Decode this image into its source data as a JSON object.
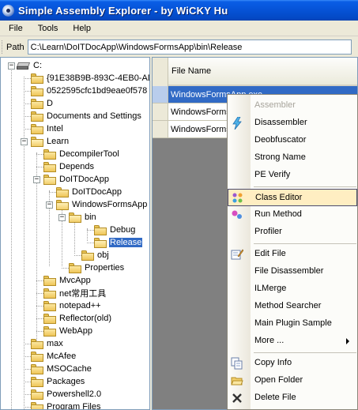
{
  "window": {
    "title": "Simple Assembly Explorer - by WiCKY Hu"
  },
  "menu": {
    "items": [
      "File",
      "Tools",
      "Help"
    ]
  },
  "path": {
    "label": "Path",
    "value": "C:\\Learn\\DoITDocApp\\WindowsFormsApp\\bin\\Release"
  },
  "tree": {
    "root": "C:",
    "nodes": [
      {
        "label": "{91E38B9B-893C-4EB0-AD"
      },
      {
        "label": "0522595cfc1bd9eae0f578"
      },
      {
        "label": "D"
      },
      {
        "label": "Documents and Settings"
      },
      {
        "label": "Intel"
      },
      {
        "label": "Learn"
      },
      {
        "label": "DecompilerTool"
      },
      {
        "label": "Depends"
      },
      {
        "label": "DoITDocApp"
      },
      {
        "label": "DoITDocApp"
      },
      {
        "label": "WindowsFormsApp"
      },
      {
        "label": "bin"
      },
      {
        "label": "Debug"
      },
      {
        "label": "Release"
      },
      {
        "label": "obj"
      },
      {
        "label": "Properties"
      },
      {
        "label": "MvcApp"
      },
      {
        "label": "net常用工具"
      },
      {
        "label": "notepad++"
      },
      {
        "label": "Reflector(old)"
      },
      {
        "label": "WebApp"
      },
      {
        "label": "max"
      },
      {
        "label": "McAfee"
      },
      {
        "label": "MSOCache"
      },
      {
        "label": "Packages"
      },
      {
        "label": "Powershell2.0"
      },
      {
        "label": "Program Files"
      }
    ]
  },
  "list": {
    "column_header": "File Name",
    "rows": [
      "WindowsFormsApp.exe",
      "WindowsFormsApp.pdb",
      "WindowsFormsApp.vshost.exe"
    ]
  },
  "context_menu": {
    "items": [
      {
        "label": "Assembler",
        "icon": "none",
        "disabled": true
      },
      {
        "label": "Disassembler",
        "icon": "lightning-icon"
      },
      {
        "label": "Deobfuscator",
        "icon": "none"
      },
      {
        "label": "Strong Name",
        "icon": "none"
      },
      {
        "label": "PE Verify",
        "icon": "none"
      },
      {
        "label": "Class Editor",
        "icon": "class-editor-icon",
        "highlighted": true
      },
      {
        "label": "Run Method",
        "icon": "run-method-icon"
      },
      {
        "label": "Profiler",
        "icon": "none"
      },
      {
        "label": "Edit File",
        "icon": "edit-file-icon"
      },
      {
        "label": "File Disassembler",
        "icon": "none"
      },
      {
        "label": "ILMerge",
        "icon": "none"
      },
      {
        "label": "Method Searcher",
        "icon": "none"
      },
      {
        "label": "Main Plugin Sample",
        "icon": "none"
      },
      {
        "label": "More ...",
        "icon": "none",
        "submenu": true
      },
      {
        "label": "Copy Info",
        "icon": "copy-icon"
      },
      {
        "label": "Open Folder",
        "icon": "open-folder-icon"
      },
      {
        "label": "Delete File",
        "icon": "delete-x-icon"
      }
    ]
  },
  "colors": {
    "title_bar": "#0654d8",
    "selection": "#316ac5",
    "menu_highlight": "#ffeec2"
  }
}
